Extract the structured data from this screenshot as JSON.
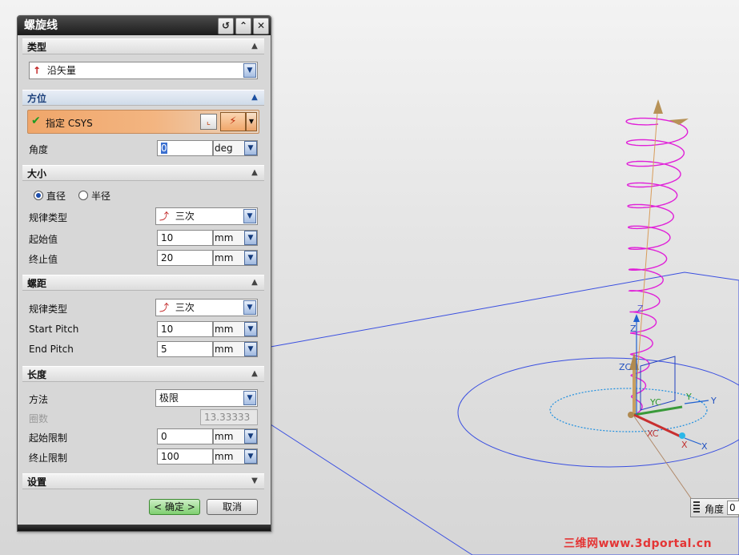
{
  "dialog": {
    "title": "螺旋线",
    "sections": {
      "type": {
        "label": "类型",
        "selected": "沿矢量"
      },
      "orientation": {
        "label": "方位",
        "specify_csys": "指定 CSYS",
        "angle_label": "角度",
        "angle_value": "0",
        "angle_unit": "deg"
      },
      "size": {
        "label": "大小",
        "radio_diameter": "直径",
        "radio_radius": "半径",
        "law_type_label": "规律类型",
        "law_type_value": "三次",
        "start_label": "起始值",
        "start_value": "10",
        "start_unit": "mm",
        "end_label": "终止值",
        "end_value": "20",
        "end_unit": "mm"
      },
      "pitch": {
        "label": "螺距",
        "law_type_label": "规律类型",
        "law_type_value": "三次",
        "start_label": "Start Pitch",
        "start_value": "10",
        "start_unit": "mm",
        "end_label": "End Pitch",
        "end_value": "5",
        "end_unit": "mm"
      },
      "length": {
        "label": "长度",
        "method_label": "方法",
        "method_value": "极限",
        "turns_label": "圈数",
        "turns_value": "13.33333",
        "start_limit_label": "起始限制",
        "start_limit_value": "0",
        "start_limit_unit": "mm",
        "end_limit_label": "终止限制",
        "end_limit_value": "100",
        "end_limit_unit": "mm"
      },
      "settings": {
        "label": "设置"
      }
    },
    "buttons": {
      "ok": "< 确定 >",
      "cancel": "取消"
    }
  },
  "viewport": {
    "axis_labels": {
      "z": "Z",
      "zc": "ZC",
      "z_top": "Z",
      "yc": "YC",
      "y1": "Y",
      "y2": "Y",
      "xc": "XC",
      "x1": "X",
      "x2": "X"
    },
    "angle_widget": {
      "label": "角度",
      "value": "0"
    },
    "watermark": "三维网www.3dportal.cn"
  },
  "colors": {
    "helix": "#e020d8",
    "plane": "#3a4fe0",
    "accent_orange": "#f0a66a",
    "ok_green": "#7fcf70"
  }
}
